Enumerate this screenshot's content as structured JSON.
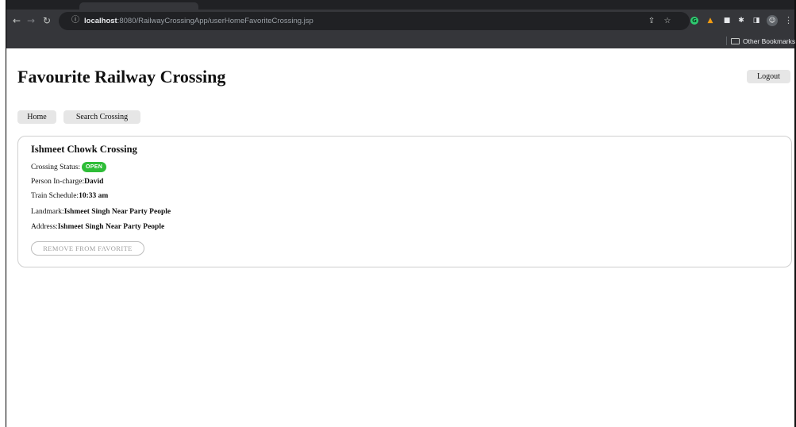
{
  "browser": {
    "url_host": "localhost",
    "url_rest": ":8080/RailwayCrossingApp/userHomeFavoriteCrossing.jsp",
    "bookmarks_folder": "Other Bookmarks",
    "icons": {
      "back": "back-arrow-icon",
      "forward": "forward-arrow-icon",
      "reload": "reload-icon",
      "info": "info-icon",
      "share": "share-icon",
      "star": "bookmark-star-icon",
      "menu": "kebab-menu-icon"
    }
  },
  "header": {
    "title": "Favourite Railway Crossing",
    "logout_label": "Logout"
  },
  "nav": {
    "home_label": "Home",
    "search_label": "Search Crossing"
  },
  "crossing": {
    "name": "Ishmeet Chowk Crossing",
    "status_label": "Crossing Status:",
    "status_value": "OPEN",
    "status_color": "#2ebd37",
    "person_label": "Person In-charge:",
    "person_value": "David",
    "train_label": "Train Schedule:",
    "train_value": "10:33 am",
    "landmark_label": "Landmark:",
    "landmark_value": "Ishmeet Singh Near Party People",
    "address_label": "Address:",
    "address_value": "Ishmeet Singh Near Party People",
    "remove_label": "REMOVE FROM FAVORITE"
  }
}
